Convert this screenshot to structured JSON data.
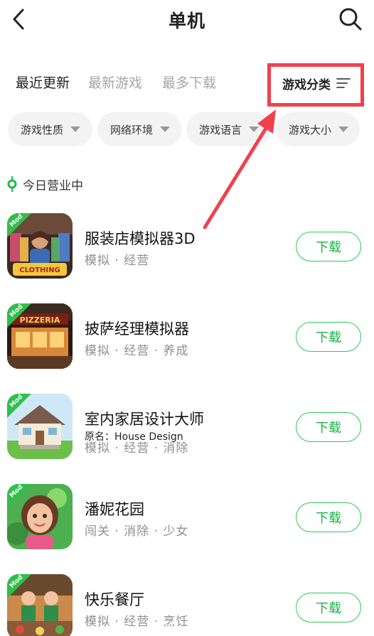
{
  "header": {
    "title": "单机"
  },
  "tabs": [
    {
      "label": "最近更新",
      "active": true
    },
    {
      "label": "最新游戏",
      "active": false
    },
    {
      "label": "最多下载",
      "active": false
    }
  ],
  "category_button": {
    "label": "游戏分类"
  },
  "filters": [
    {
      "label": "游戏性质"
    },
    {
      "label": "网络环境"
    },
    {
      "label": "游戏语言"
    },
    {
      "label": "游戏大小"
    }
  ],
  "section": {
    "title": "今日营业中"
  },
  "apps": [
    {
      "name": "服装店模拟器3D",
      "alt_name": "",
      "tags": "模拟 · 经营",
      "badge": "Mod",
      "button": "下载",
      "icon_text": "CLOTHING"
    },
    {
      "name": "披萨经理模拟器",
      "alt_name": "",
      "tags": "模拟 · 经营 · 养成",
      "badge": "Mod",
      "button": "下载",
      "icon_text": "PIZZERIA"
    },
    {
      "name": "室内家居设计大师",
      "alt_name": "原名：House Design",
      "tags": "模拟 · 经营 · 消除",
      "badge": "Mod",
      "button": "下载",
      "icon_text": ""
    },
    {
      "name": "潘妮花园",
      "alt_name": "",
      "tags": "闯关 · 消除 · 少女",
      "badge": "Mod",
      "button": "下载",
      "icon_text": ""
    },
    {
      "name": "快乐餐厅",
      "alt_name": "",
      "tags": "模拟 · 经营 · 烹饪",
      "badge": "Mod",
      "button": "下载",
      "icon_text": ""
    }
  ],
  "colors": {
    "accent_green": "#19b445",
    "highlight_red": "#f0414f",
    "tab_underline": "#b6f0cd"
  },
  "icons": [
    "back-icon",
    "search-icon",
    "filter-lines-icon",
    "caret-down-icon",
    "location-pin-icon"
  ]
}
